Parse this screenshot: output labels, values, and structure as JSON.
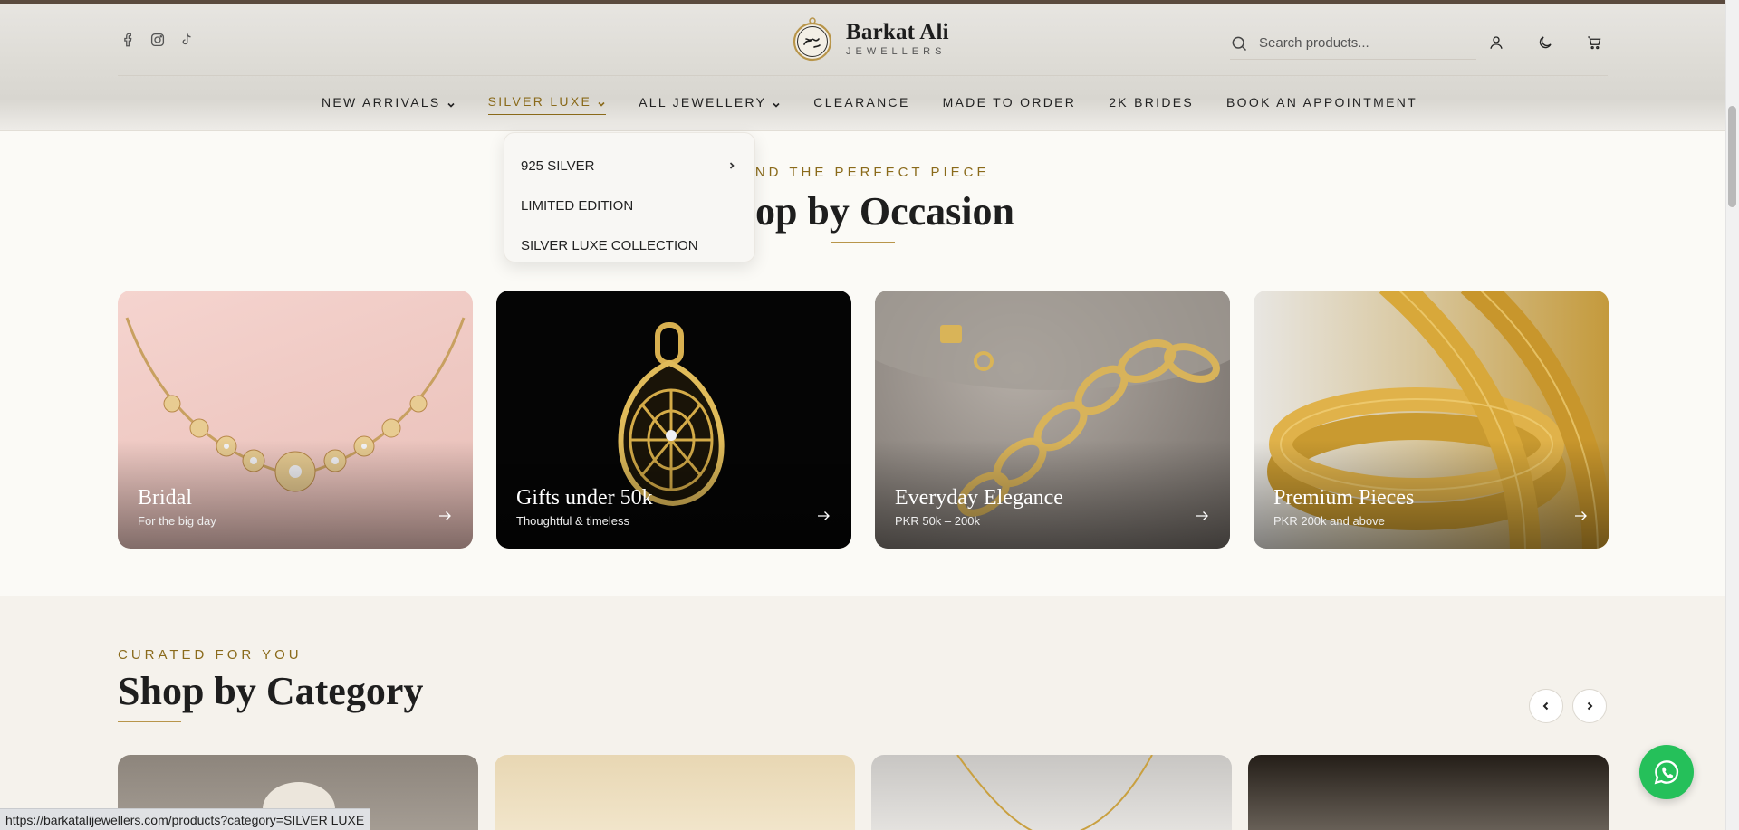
{
  "header": {
    "brand_name": "Barkat Ali",
    "brand_sub": "JEWELLERS",
    "social_icons": [
      "facebook-icon",
      "instagram-icon",
      "tiktok-icon"
    ],
    "search_placeholder": "Search products...",
    "header_icons": [
      "user-icon",
      "moon-icon",
      "cart-icon"
    ]
  },
  "nav": {
    "items": [
      {
        "label": "NEW ARRIVALS",
        "has_dropdown": true
      },
      {
        "label": "SILVER LUXE",
        "has_dropdown": true,
        "active": true
      },
      {
        "label": "ALL JEWELLERY",
        "has_dropdown": true
      },
      {
        "label": "CLEARANCE",
        "has_dropdown": false
      },
      {
        "label": "MADE TO ORDER",
        "has_dropdown": false
      },
      {
        "label": "2K BRIDES",
        "has_dropdown": false
      },
      {
        "label": "BOOK AN APPOINTMENT",
        "has_dropdown": false
      }
    ]
  },
  "dropdown": {
    "items": [
      {
        "label": "925 SILVER",
        "has_submenu": true
      },
      {
        "label": "LIMITED EDITION",
        "has_submenu": false
      },
      {
        "label": "SILVER LUXE COLLECTION",
        "has_submenu": false
      }
    ]
  },
  "occasion": {
    "eyebrow": "FIND THE PERFECT PIECE",
    "title": "Shop by Occasion",
    "cards": [
      {
        "title": "Bridal",
        "subtitle": "For the big day"
      },
      {
        "title": "Gifts under 50k",
        "subtitle": "Thoughtful & timeless"
      },
      {
        "title": "Everyday Elegance",
        "subtitle": "PKR 50k – 200k"
      },
      {
        "title": "Premium Pieces",
        "subtitle": "PKR 200k and above"
      }
    ]
  },
  "category": {
    "eyebrow": "CURATED FOR YOU",
    "title": "Shop by Category"
  },
  "status_url": "https://barkatalijewellers.com/products?category=SILVER LUXE",
  "colors": {
    "accent_gold": "#8a6a1a",
    "whatsapp_green": "#25c05a",
    "page_bg": "#fbfaf6"
  }
}
